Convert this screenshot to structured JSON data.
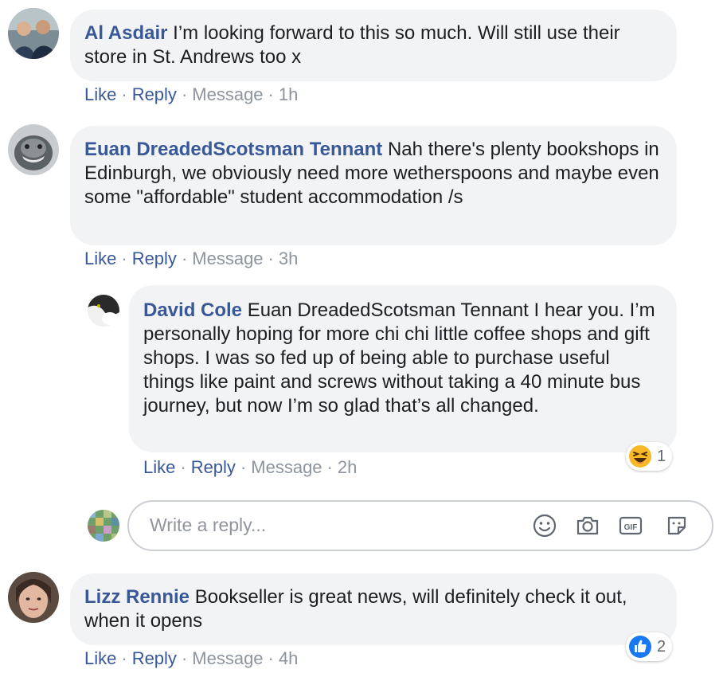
{
  "actions": {
    "like": "Like",
    "reply": "Reply",
    "message": "Message",
    "separator": "·"
  },
  "comments": [
    {
      "author": "Al Asdair",
      "text": "I’m looking forward to this so much. Will still use their store in St. Andrews too x",
      "time": "1h"
    },
    {
      "author": "Euan DreadedScotsman Tennant",
      "text": "Nah there's plenty bookshops in Edinburgh, we obviously need more wetherspoons and maybe even some \"affordable\" student accommodation /s",
      "time": "3h"
    },
    {
      "author": "David Cole",
      "text": "Euan DreadedScotsman Tennant I hear you. I’m personally hoping for more chi chi little coffee shops and gift shops. I was so fed up of being able to purchase useful things like paint and screws without taking a 40 minute bus journey, but now I’m so glad that’s all changed.",
      "time": "2h",
      "reaction": {
        "icon": "haha-emoji-icon",
        "count": "1"
      }
    },
    {
      "author": "Lizz Rennie",
      "text": "Bookseller is great news, will definitely check it out, when it opens",
      "time": "4h",
      "reaction": {
        "icon": "like-thumb-icon",
        "count": "2"
      }
    }
  ],
  "reply_box": {
    "placeholder": "Write a reply...",
    "icons": [
      "emoji-icon",
      "camera-icon",
      "gif-icon",
      "sticker-icon"
    ]
  },
  "colors": {
    "link": "#385898",
    "bubble": "#f2f3f5",
    "meta": "#8d949e",
    "like_blue": "#1877f2"
  }
}
